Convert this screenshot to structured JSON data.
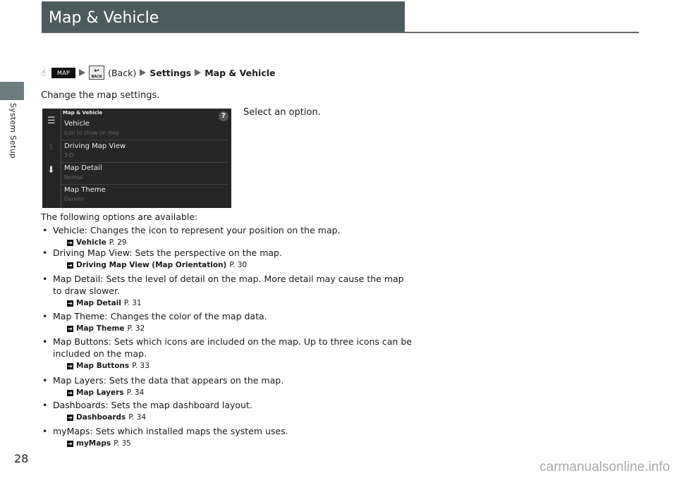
{
  "section": "System Setup",
  "title": "Map & Vehicle",
  "breadcrumb": {
    "map_button": "MAP",
    "back_button": "BACK",
    "back_text": "(Back)",
    "steps": [
      "Settings",
      "Map & Vehicle"
    ]
  },
  "intro": "Change the map settings.",
  "screen": {
    "header": "Map & Vehicle",
    "help": "?",
    "items": [
      {
        "label": "Vehicle",
        "value": "Icon to show on map"
      },
      {
        "label": "Driving Map View",
        "value": "3-D"
      },
      {
        "label": "Map Detail",
        "value": "Normal"
      },
      {
        "label": "Map Theme",
        "value": "Garmin"
      }
    ]
  },
  "instruction": "Select an option.",
  "options_intro": "The following options are available:",
  "options": [
    {
      "name": "Vehicle",
      "desc": ": Changes the icon to represent your position on the map.",
      "ref": "Vehicle",
      "page": "P. 29"
    },
    {
      "name": "Driving Map View",
      "desc": ": Sets the perspective on the map.",
      "ref": "Driving Map View (Map Orientation)",
      "page": "P. 30"
    },
    {
      "name": "Map Detail",
      "desc": ": Sets the level of detail on the map. More detail may cause the map to draw slower.",
      "ref": "Map Detail",
      "page": "P. 31"
    },
    {
      "name": "Map Theme",
      "desc": ": Changes the color of the map data.",
      "ref": "Map Theme",
      "page": "P. 32"
    },
    {
      "name": "Map Buttons",
      "desc": ": Sets which icons are included on the map. Up to three icons can be included on the map.",
      "ref": "Map Buttons",
      "page": "P. 33"
    },
    {
      "name": "Map Layers",
      "desc": ": Sets the data that appears on the map.",
      "ref": "Map Layers",
      "page": "P. 34"
    },
    {
      "name": "Dashboards",
      "desc": ": Sets the map dashboard layout.",
      "ref": "Dashboards",
      "page": "P. 34"
    },
    {
      "name": "myMaps",
      "desc": ": Sets which installed maps the system uses.",
      "ref": "myMaps",
      "page": "P. 35"
    }
  ],
  "page_number": "28",
  "watermark": "carmanualsonline.info"
}
